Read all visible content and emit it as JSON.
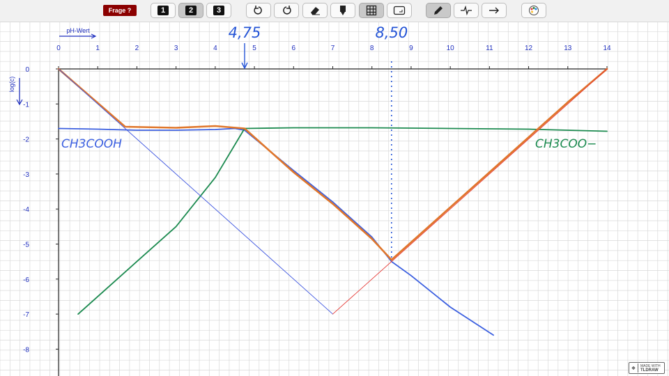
{
  "toolbar": {
    "frage_label": "Frage ?",
    "page_buttons": [
      "1",
      "2",
      "3"
    ],
    "active_page": "2",
    "tools": [
      "undo-icon",
      "redo-icon",
      "eraser-icon",
      "marker-icon",
      "grid-icon",
      "frame-icon",
      "pencil-icon",
      "pulse-icon",
      "arrow-icon",
      "palette-icon"
    ],
    "active_tools": [
      "grid-icon",
      "pencil-icon"
    ]
  },
  "badge": {
    "top": "MADE WITH",
    "bottom": "TLDRAW"
  },
  "chart_data": {
    "type": "line",
    "xlabel": "pH-Wert",
    "ylabel": "log(c)",
    "xlim": [
      0,
      14
    ],
    "ylim": [
      -8,
      0
    ],
    "xticks": [
      "0",
      "1",
      "2",
      "3",
      "4",
      "5",
      "6",
      "7",
      "8",
      "9",
      "10",
      "11",
      "12",
      "13",
      "14"
    ],
    "yticks": [
      "0",
      "-1",
      "-2",
      "-3",
      "-4",
      "-5",
      "-6",
      "-7",
      "-8"
    ],
    "annotations": [
      {
        "text": "4,75",
        "x": 4.75,
        "color": "#2454d6"
      },
      {
        "text": "8,50",
        "x": 8.5,
        "color": "#2454d6"
      }
    ],
    "series": [
      {
        "name": "CH3COOH",
        "color": "#3b5fe0",
        "points": [
          [
            0,
            -1.7
          ],
          [
            1,
            -1.72
          ],
          [
            2,
            -1.75
          ],
          [
            3,
            -1.75
          ],
          [
            4,
            -1.73
          ],
          [
            4.5,
            -1.7
          ],
          [
            4.75,
            -1.75
          ],
          [
            6,
            -2.9
          ],
          [
            7,
            -3.8
          ],
          [
            8,
            -4.8
          ],
          [
            8.5,
            -5.5
          ],
          [
            9,
            -5.9
          ],
          [
            10,
            -6.8
          ],
          [
            11.1,
            -7.6
          ]
        ]
      },
      {
        "name": "CH3COO−",
        "color": "#1b8a4f",
        "points": [
          [
            0.5,
            -7.0
          ],
          [
            2,
            -5.5
          ],
          [
            3,
            -4.5
          ],
          [
            4,
            -3.1
          ],
          [
            4.75,
            -1.7
          ],
          [
            6,
            -1.68
          ],
          [
            8,
            -1.68
          ],
          [
            10,
            -1.7
          ],
          [
            12,
            -1.72
          ],
          [
            14,
            -1.78
          ]
        ]
      },
      {
        "name": "",
        "color": "#e0762a",
        "points": [
          [
            0,
            0
          ],
          [
            1.7,
            -1.65
          ],
          [
            3,
            -1.68
          ],
          [
            4,
            -1.63
          ],
          [
            4.75,
            -1.7
          ],
          [
            6,
            -2.95
          ],
          [
            7,
            -3.85
          ],
          [
            8,
            -4.85
          ],
          [
            8.5,
            -5.45
          ],
          [
            10,
            -3.95
          ],
          [
            11,
            -2.95
          ],
          [
            12,
            -1.95
          ],
          [
            13,
            -0.95
          ],
          [
            14,
            0
          ]
        ]
      },
      {
        "name": "",
        "color": "#3d55e0",
        "points": [
          [
            0,
            0
          ],
          [
            7,
            -7
          ]
        ]
      },
      {
        "name": "",
        "color": "#e53935",
        "points": [
          [
            7,
            -7
          ],
          [
            14,
            0
          ]
        ]
      }
    ],
    "markers": [
      {
        "x": 8.5,
        "style": "dotted",
        "color": "#2454d6"
      }
    ]
  }
}
